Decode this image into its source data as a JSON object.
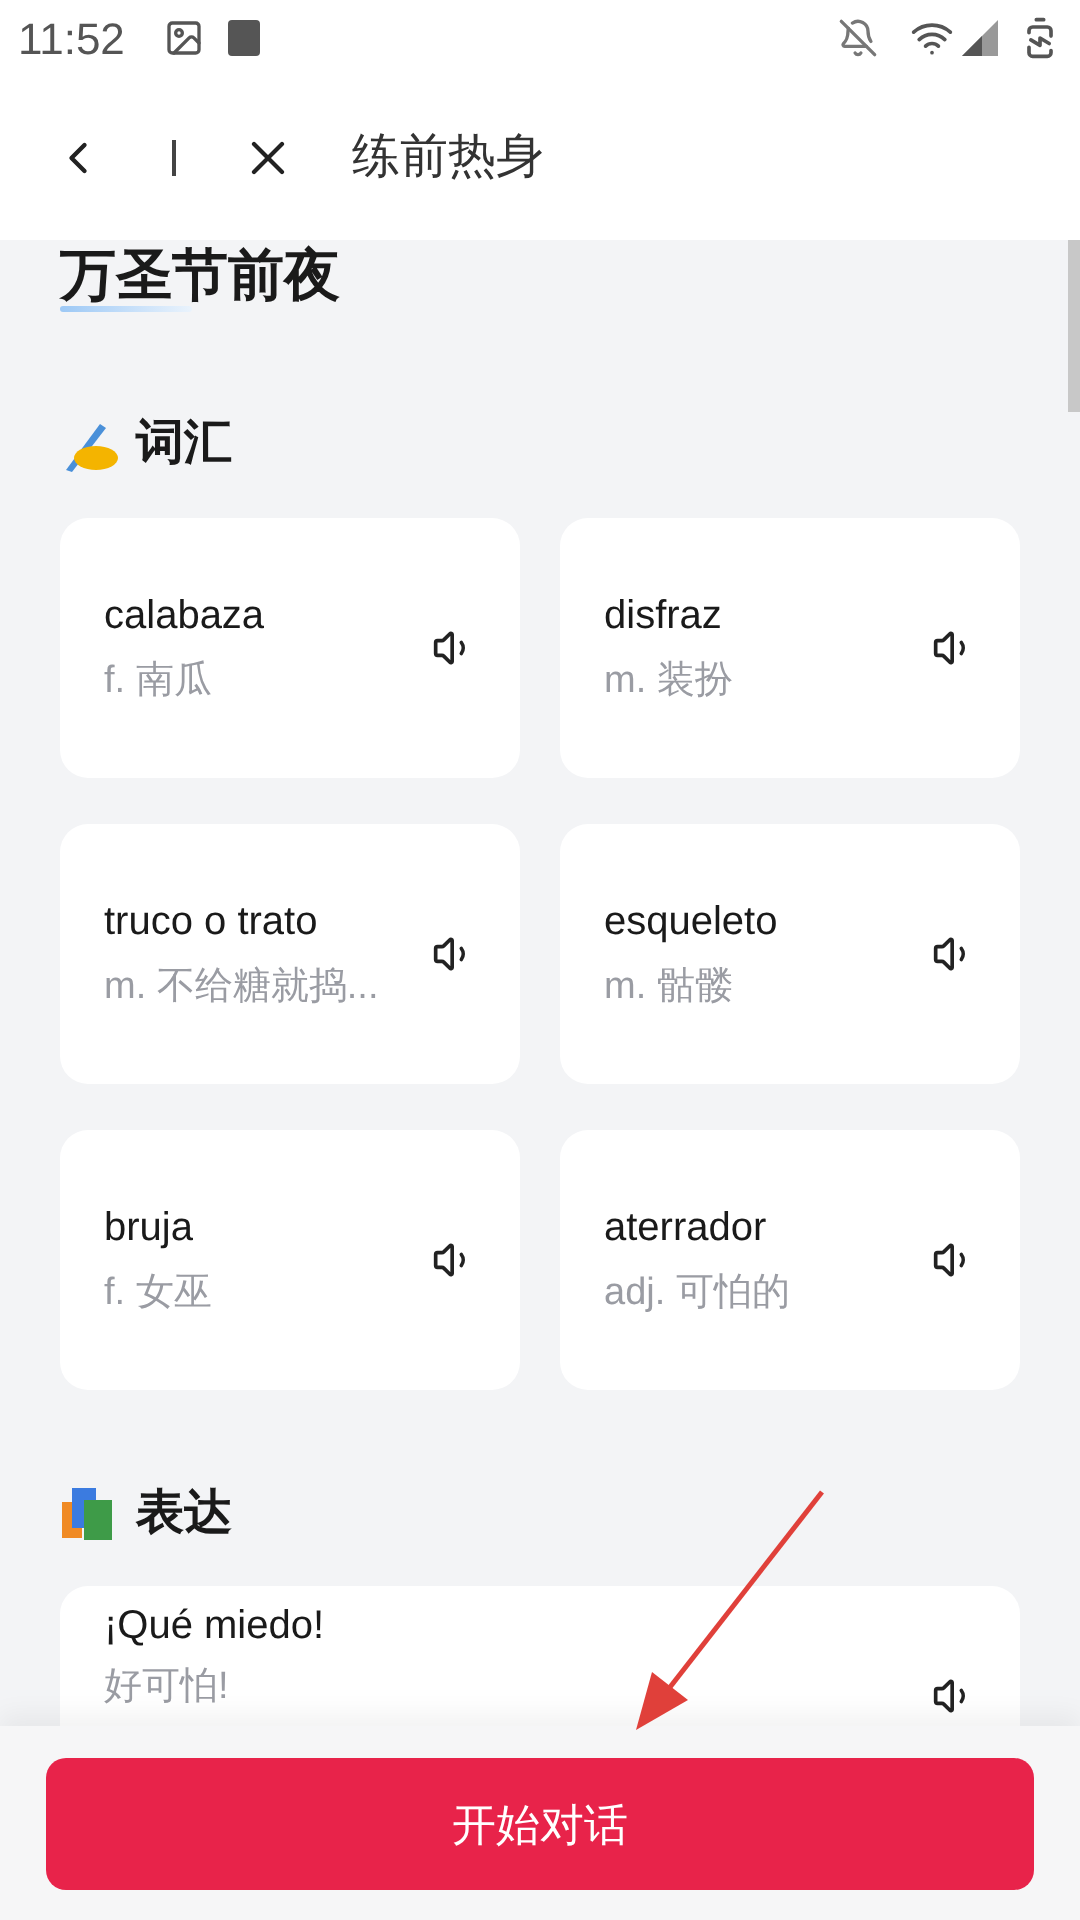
{
  "status_bar": {
    "time": "11:52"
  },
  "header": {
    "title": "练前热身"
  },
  "lesson_title": "万圣节前夜",
  "vocabulary": {
    "heading": "词汇",
    "words": [
      {
        "word": "calabaza",
        "meaning": "f. 南瓜"
      },
      {
        "word": "disfraz",
        "meaning": "m. 装扮"
      },
      {
        "word": "truco o trato",
        "meaning": "m. 不给糖就捣..."
      },
      {
        "word": "esqueleto",
        "meaning": "m. 骷髅"
      },
      {
        "word": "bruja",
        "meaning": "f. 女巫"
      },
      {
        "word": "aterrador",
        "meaning": "adj. 可怕的"
      }
    ]
  },
  "expressions": {
    "heading": "表达",
    "items": [
      {
        "phrase": "¡Qué miedo!",
        "meaning": "好可怕!"
      }
    ]
  },
  "start_button": "开始对话"
}
